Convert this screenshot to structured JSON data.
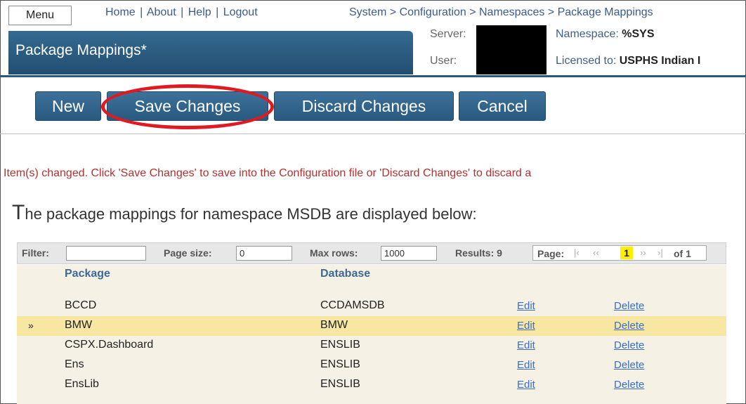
{
  "top": {
    "menu_label": "Menu",
    "links": [
      "Home",
      "About",
      "Help",
      "Logout"
    ],
    "separator": "|",
    "breadcrumb": "System > Configuration > Namespaces > Package Mappings"
  },
  "page": {
    "title": "Package Mappings*",
    "server_label": "Server:",
    "user_label": "User:",
    "namespace_label": "Namespace:",
    "namespace_value": "%SYS",
    "licensed_label": "Licensed to:",
    "licensed_value": "USPHS Indian I"
  },
  "toolbar": {
    "new_label": "New",
    "save_label": "Save Changes",
    "discard_label": "Discard Changes",
    "cancel_label": "Cancel"
  },
  "colors": {
    "highlight_ring": "#e11a22",
    "header_blue": "#2c587a",
    "message_red": "#b33030",
    "selected_row": "#f8e7a3",
    "current_page": "#ffee00"
  },
  "message": "Item(s) changed. Click 'Save Changes' to save into the Configuration file or 'Discard Changes' to discard a",
  "heading": {
    "first_letter": "T",
    "rest": "he package mappings for namespace MSDB are displayed below:"
  },
  "filter_bar": {
    "filter_label": "Filter:",
    "filter_value": "",
    "page_size_label": "Page size:",
    "page_size_value": "0",
    "max_rows_label": "Max rows:",
    "max_rows_value": "1000",
    "results_label": "Results: 9",
    "page_label": "Page:",
    "first_icon": "«first",
    "prev_icon": "«prev",
    "current_page": "1",
    "next_icon": "next»",
    "last_icon": "last»",
    "of_label": "of 1"
  },
  "table": {
    "columns": [
      "Package",
      "Database"
    ],
    "selected_marker": "»",
    "edit_label": "Edit",
    "delete_label": "Delete",
    "rows": [
      {
        "package": "BCCD",
        "database": "CCDAMSDB",
        "selected": false
      },
      {
        "package": "BMW",
        "database": "BMW",
        "selected": true
      },
      {
        "package": "CSPX.Dashboard",
        "database": "ENSLIB",
        "selected": false
      },
      {
        "package": "Ens",
        "database": "ENSLIB",
        "selected": false
      },
      {
        "package": "EnsLib",
        "database": "ENSLIB",
        "selected": false
      }
    ]
  }
}
